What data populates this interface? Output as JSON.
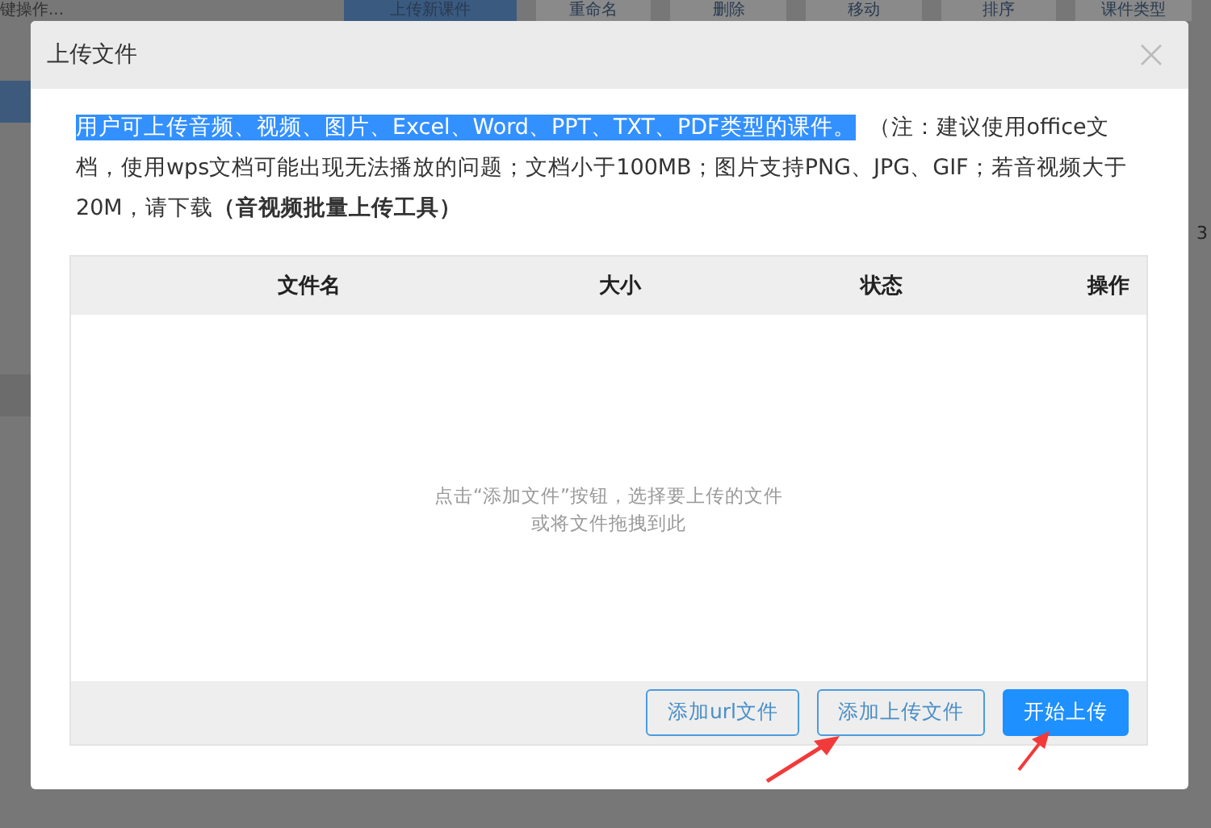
{
  "background": {
    "sidebar_label": "键操作...",
    "toolbar": [
      "上传新课件",
      "重命名",
      "删除",
      "移动",
      "排序",
      "课件类型"
    ],
    "side_value": "3"
  },
  "dialog": {
    "title": "上传文件",
    "notice": [
      {
        "text": "用户可上传音频、视频、图片、Excel、Word、PPT、TXT、PDF类型的课件。",
        "highlighted": true
      },
      {
        "text": "（注：建议使用office文档，使用wps文档可能出现无法播放的问题；文档小于100MB；图片支持PNG、JPG、GIF；若音视频大于20M，请下载**（音视频批量上传工具）**",
        "highlighted": false
      }
    ],
    "table": {
      "columns": [
        "文件名",
        "大小",
        "状态",
        "操作"
      ],
      "empty_hint": [
        "点击“添加文件”按钮，选择要上传的文件",
        "或将文件拖拽到此"
      ]
    },
    "buttons": [
      {
        "label": "添加url文件",
        "kind": "outline"
      },
      {
        "label": "添加上传文件",
        "kind": "outline"
      },
      {
        "label": "开始上传",
        "kind": "primary"
      }
    ]
  }
}
